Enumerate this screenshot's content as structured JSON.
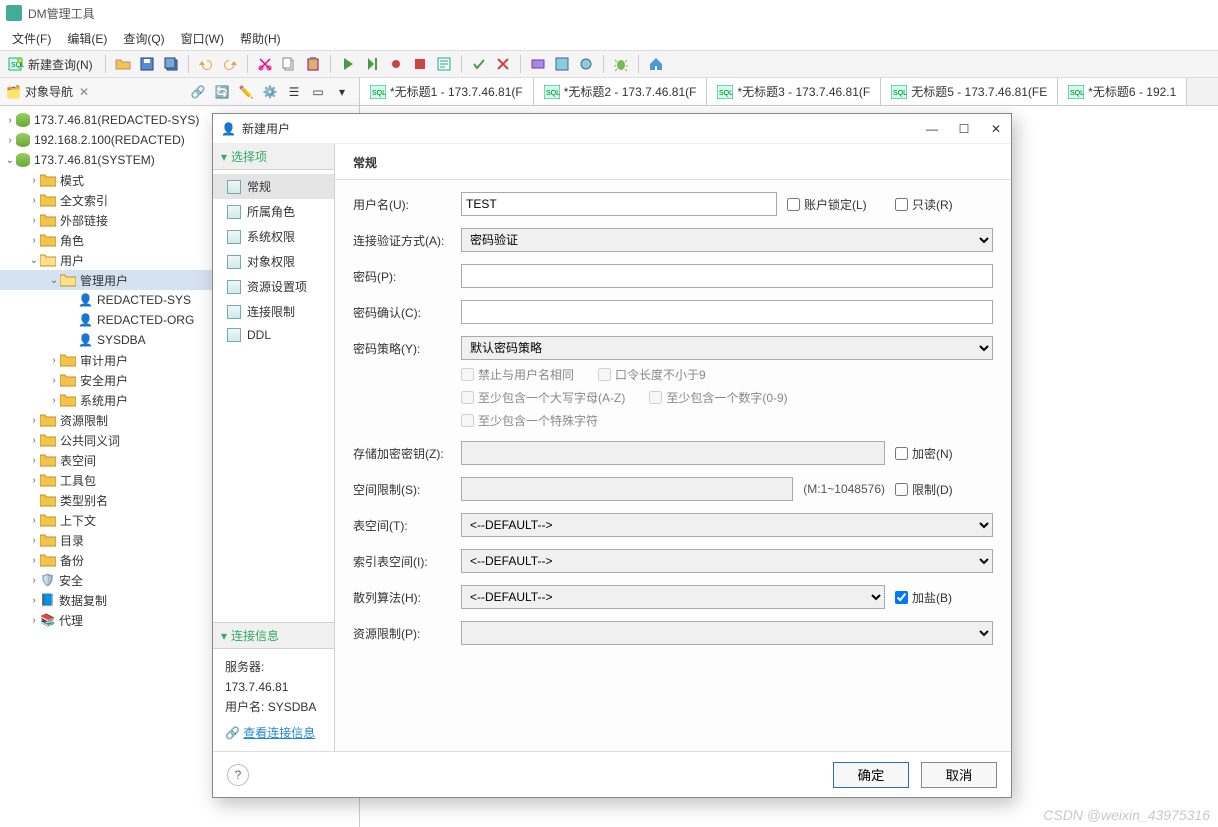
{
  "app": {
    "title": "DM管理工具"
  },
  "menu": [
    "文件(F)",
    "编辑(E)",
    "查询(Q)",
    "窗口(W)",
    "帮助(H)"
  ],
  "toolbar": {
    "newQuery": "新建查询(N)"
  },
  "nav": {
    "title": "对象导航",
    "conn1": "173.7.46.81(REDACTED-SYS)",
    "conn2": "192.168.2.100(REDACTED)",
    "conn3": "173.7.46.81(SYSTEM)",
    "items": {
      "schema": "模式",
      "fulltext": "全文索引",
      "extlink": "外部链接",
      "role": "角色",
      "user": "用户",
      "mguser": "管理用户",
      "u1": "REDACTED-SYS",
      "u2": "REDACTED-ORG",
      "u3": "SYSDBA",
      "audituser": "审计用户",
      "secuser": "安全用户",
      "sysuser": "系统用户",
      "reslimit": "资源限制",
      "synonym": "公共同义词",
      "tablespace": "表空间",
      "toolkit": "工具包",
      "typealias": "类型别名",
      "context": "上下文",
      "catalog": "目录",
      "backup": "备份",
      "security": "安全",
      "replication": "数据复制",
      "agent": "代理"
    }
  },
  "tabs": [
    "*无标题1 - 173.7.46.81(F",
    "*无标题2 - 173.7.46.81(F",
    "*无标题3 - 173.7.46.81(F",
    "无标题5 - 173.7.46.81(FE",
    "*无标题6 - 192.1"
  ],
  "dialog": {
    "title": "新建用户",
    "sections": {
      "options": "选择项",
      "conninfo": "连接信息"
    },
    "opts": [
      "常规",
      "所属角色",
      "系统权限",
      "对象权限",
      "资源设置项",
      "连接限制",
      "DDL"
    ],
    "conn": {
      "serverLabel": "服务器:",
      "serverVal": "173.7.46.81",
      "userLabel": "用户名:",
      "userVal": "SYSDBA",
      "link": "查看连接信息"
    },
    "form": {
      "heading": "常规",
      "username": {
        "label": "用户名(U):",
        "value": "TEST"
      },
      "lockLabel": "账户锁定(L)",
      "readonlyLabel": "只读(R)",
      "authmode": {
        "label": "连接验证方式(A):",
        "value": "密码验证"
      },
      "password": {
        "label": "密码(P):"
      },
      "passwordConfirm": {
        "label": "密码确认(C):"
      },
      "policy": {
        "label": "密码策略(Y):",
        "value": "默认密码策略"
      },
      "policyOpts": {
        "a": "禁止与用户名相同",
        "b": "口令长度不小于9",
        "c": "至少包含一个大写字母(A-Z)",
        "d": "至少包含一个数字(0-9)",
        "e": "至少包含一个特殊字符"
      },
      "encryptKey": {
        "label": "存储加密密钥(Z):",
        "chk": "加密(N)"
      },
      "spaceLimit": {
        "label": "空间限制(S):",
        "hint": "(M:1~1048576)",
        "chk": "限制(D)"
      },
      "tablespace": {
        "label": "表空间(T):",
        "value": "<--DEFAULT-->"
      },
      "indexts": {
        "label": "索引表空间(I):",
        "value": "<--DEFAULT-->"
      },
      "hash": {
        "label": "散列算法(H):",
        "value": "<--DEFAULT-->",
        "chk": "加盐(B)"
      },
      "reslimit": {
        "label": "资源限制(P):"
      }
    },
    "buttons": {
      "ok": "确定",
      "cancel": "取消"
    }
  },
  "watermark": "CSDN @weixin_43975316"
}
